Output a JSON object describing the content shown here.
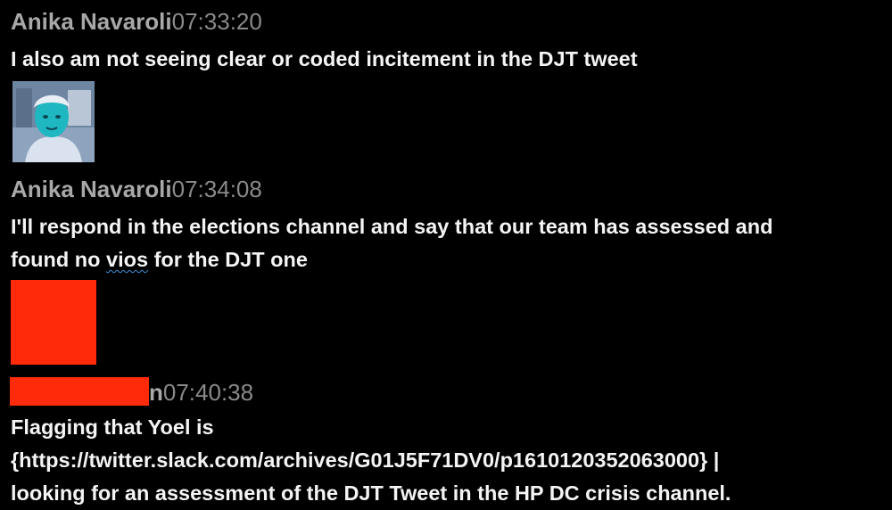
{
  "messages": [
    {
      "sender": "Anika Navaroli",
      "time": "07:33:20",
      "lines": [
        "I also am not seeing clear or coded incitement in the DJT tweet"
      ]
    },
    {
      "sender": "Anika Navaroli",
      "time": "07:34:08",
      "line1": "I'll respond in the elections channel and say that our team has assessed and",
      "line2_before": "found no ",
      "line2_word": "vios",
      "line2_after": " for the DJT one"
    },
    {
      "sender_visible_tail": "n",
      "time": "07:40:38",
      "lines": [
        "Flagging that Yoel is",
        "{https://twitter.slack.com/archives/G01J5F71DV0/p1610120352063000} |",
        "looking for an assessment of the DJT Tweet in the HP DC crisis channel."
      ]
    }
  ],
  "colors": {
    "background": "#000000",
    "sender": "#a8a8a8",
    "timestamp": "#8a8a8a",
    "body_text": "#f4f4f4",
    "redaction": "#ff2a0a"
  }
}
